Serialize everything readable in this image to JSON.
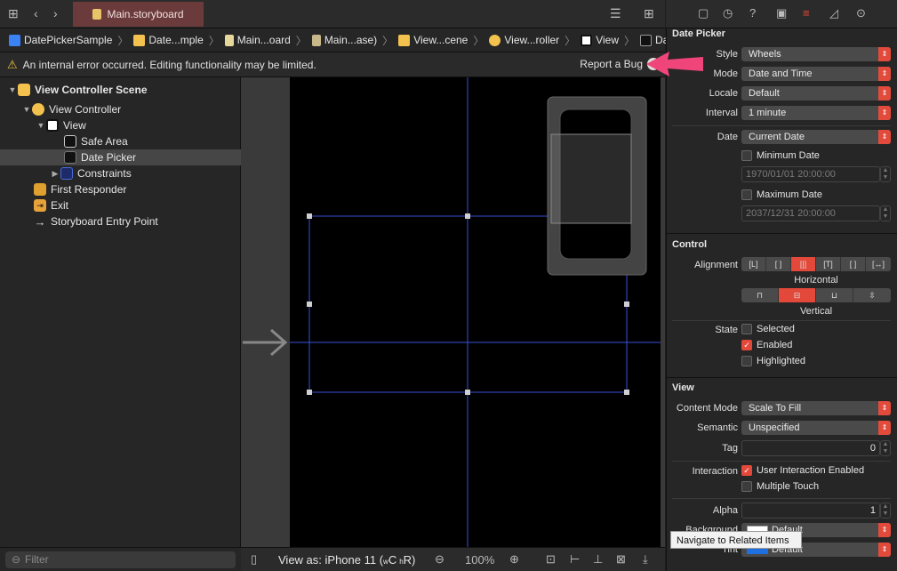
{
  "tab": {
    "title": "Main.storyboard"
  },
  "breadcrumb": [
    {
      "label": "DatePickerSample",
      "icon": "project-file-icon"
    },
    {
      "label": "Date...mple",
      "icon": "folder-icon"
    },
    {
      "label": "Main...oard",
      "icon": "storyboard-file-icon"
    },
    {
      "label": "Main...ase)",
      "icon": "storyboard-file-icon"
    },
    {
      "label": "View...cene",
      "icon": "scene-icon"
    },
    {
      "label": "View...roller",
      "icon": "view-controller-icon"
    },
    {
      "label": "View",
      "icon": "view-icon"
    },
    {
      "label": "Date Picker",
      "icon": "date-picker-icon"
    }
  ],
  "warning": {
    "message": "An internal error occurred. Editing functionality may be limited.",
    "action": "Report a Bug"
  },
  "outline": [
    {
      "label": "View Controller Scene",
      "level": 0,
      "expanded": true,
      "icon": "scene-icon",
      "bold": true
    },
    {
      "label": "View Controller",
      "level": 1,
      "expanded": true,
      "icon": "view-controller-icon"
    },
    {
      "label": "View",
      "level": 2,
      "expanded": true,
      "icon": "view-icon"
    },
    {
      "label": "Safe Area",
      "level": 3,
      "icon": "safe-area-icon"
    },
    {
      "label": "Date Picker",
      "level": 3,
      "icon": "date-picker-icon",
      "selected": true
    },
    {
      "label": "Constraints",
      "level": 3,
      "collapsed": true,
      "icon": "constraints-icon"
    },
    {
      "label": "First Responder",
      "level": 1,
      "icon": "first-responder-icon"
    },
    {
      "label": "Exit",
      "level": 1,
      "icon": "exit-icon"
    },
    {
      "label": "Storyboard Entry Point",
      "level": 1,
      "icon": "entry-arrow-icon"
    }
  ],
  "filter": {
    "placeholder": "Filter"
  },
  "bottombar": {
    "view_as": "View as: iPhone 11 (",
    "w": "w",
    "C": "C",
    "h": "h",
    "R": "R)",
    "zoom": "100%"
  },
  "inspector": {
    "date_picker_header": "Date Picker",
    "style": {
      "label": "Style",
      "value": "Wheels"
    },
    "mode": {
      "label": "Mode",
      "value": "Date and Time"
    },
    "locale": {
      "label": "Locale",
      "value": "Default"
    },
    "interval": {
      "label": "Interval",
      "value": "1 minute"
    },
    "date": {
      "label": "Date",
      "value": "Current Date"
    },
    "min_date": {
      "label": "Minimum Date",
      "value": "1970/01/01 20:00:00"
    },
    "max_date": {
      "label": "Maximum Date",
      "value": "2037/12/31 20:00:00"
    },
    "control_header": "Control",
    "alignment": {
      "label": "Alignment",
      "horizontal": "Horizontal",
      "vertical": "Vertical"
    },
    "state": {
      "label": "State",
      "selected": "Selected",
      "enabled": "Enabled",
      "highlighted": "Highlighted"
    },
    "view_header": "View",
    "content_mode": {
      "label": "Content Mode",
      "value": "Scale To Fill"
    },
    "semantic": {
      "label": "Semantic",
      "value": "Unspecified"
    },
    "tag": {
      "label": "Tag",
      "value": "0"
    },
    "interaction": {
      "label": "Interaction",
      "user": "User Interaction Enabled",
      "multi": "Multiple Touch"
    },
    "alpha": {
      "label": "Alpha",
      "value": "1"
    },
    "background": {
      "label": "Background",
      "value": "Default"
    },
    "tint": {
      "label": "Tint",
      "value": "Default"
    }
  },
  "tooltip": "Navigate to Related Items",
  "colors": {
    "accent": "#e2493a",
    "guide": "#3a4fd8",
    "annotation_arrow": "#f0457a"
  }
}
